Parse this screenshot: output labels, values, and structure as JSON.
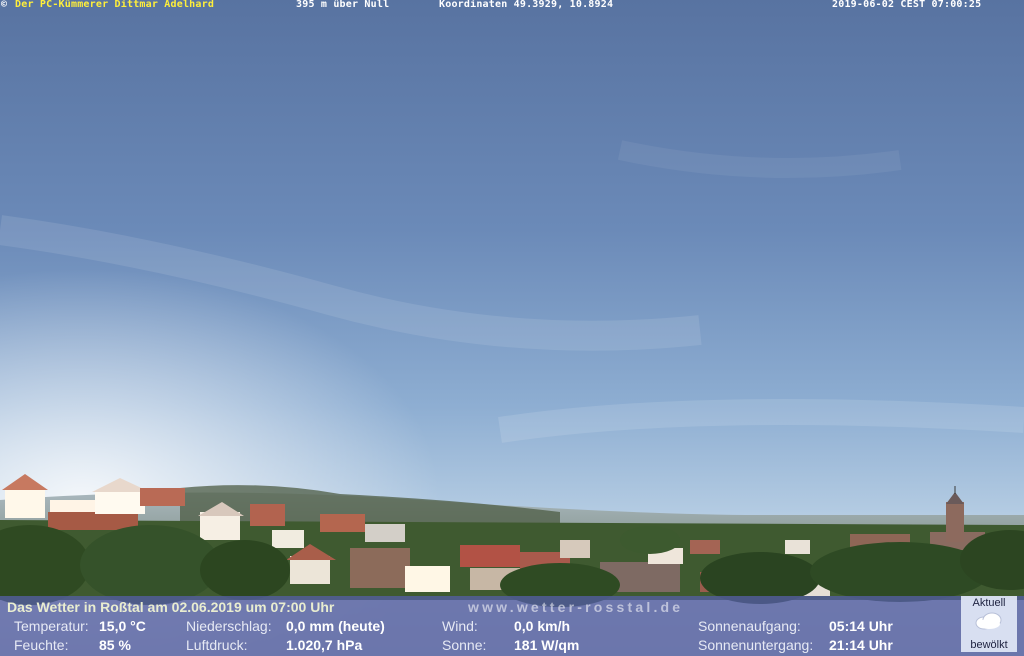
{
  "header": {
    "copyright_symbol": "©",
    "owner": "Der PC-Kümmerer Dittmar Adelhard",
    "altitude": "395 m über Null",
    "coordinates": "Koordinaten 49.3929, 10.8924",
    "timestamp": "2019-06-02 CEST 07:00:25"
  },
  "panel": {
    "headline": "Das Wetter in Roßtal am 02.06.2019 um 07:00 Uhr",
    "url": "www.wetter-rosstal.de",
    "temperature": {
      "label": "Temperatur:",
      "value": "15,0 °C"
    },
    "humidity": {
      "label": "Feuchte:",
      "value": "85 %"
    },
    "precipitation": {
      "label": "Niederschlag:",
      "value": "0,0 mm (heute)"
    },
    "pressure": {
      "label": "Luftdruck:",
      "value": "1.020,7 hPa"
    },
    "wind": {
      "label": "Wind:",
      "value": "0,0 km/h"
    },
    "sun": {
      "label": "Sonne:",
      "value": "181 W/qm"
    },
    "sunrise": {
      "label": "Sonnenaufgang:",
      "value": "05:14 Uhr"
    },
    "sunset": {
      "label": "Sonnenuntergang:",
      "value": "21:14 Uhr"
    },
    "status": {
      "top": "Aktuell",
      "bottom": "bewölkt",
      "icon": "cloud-icon"
    }
  },
  "colors": {
    "owner_text": "#ffef3a",
    "panel_bg": "#545ea0"
  }
}
